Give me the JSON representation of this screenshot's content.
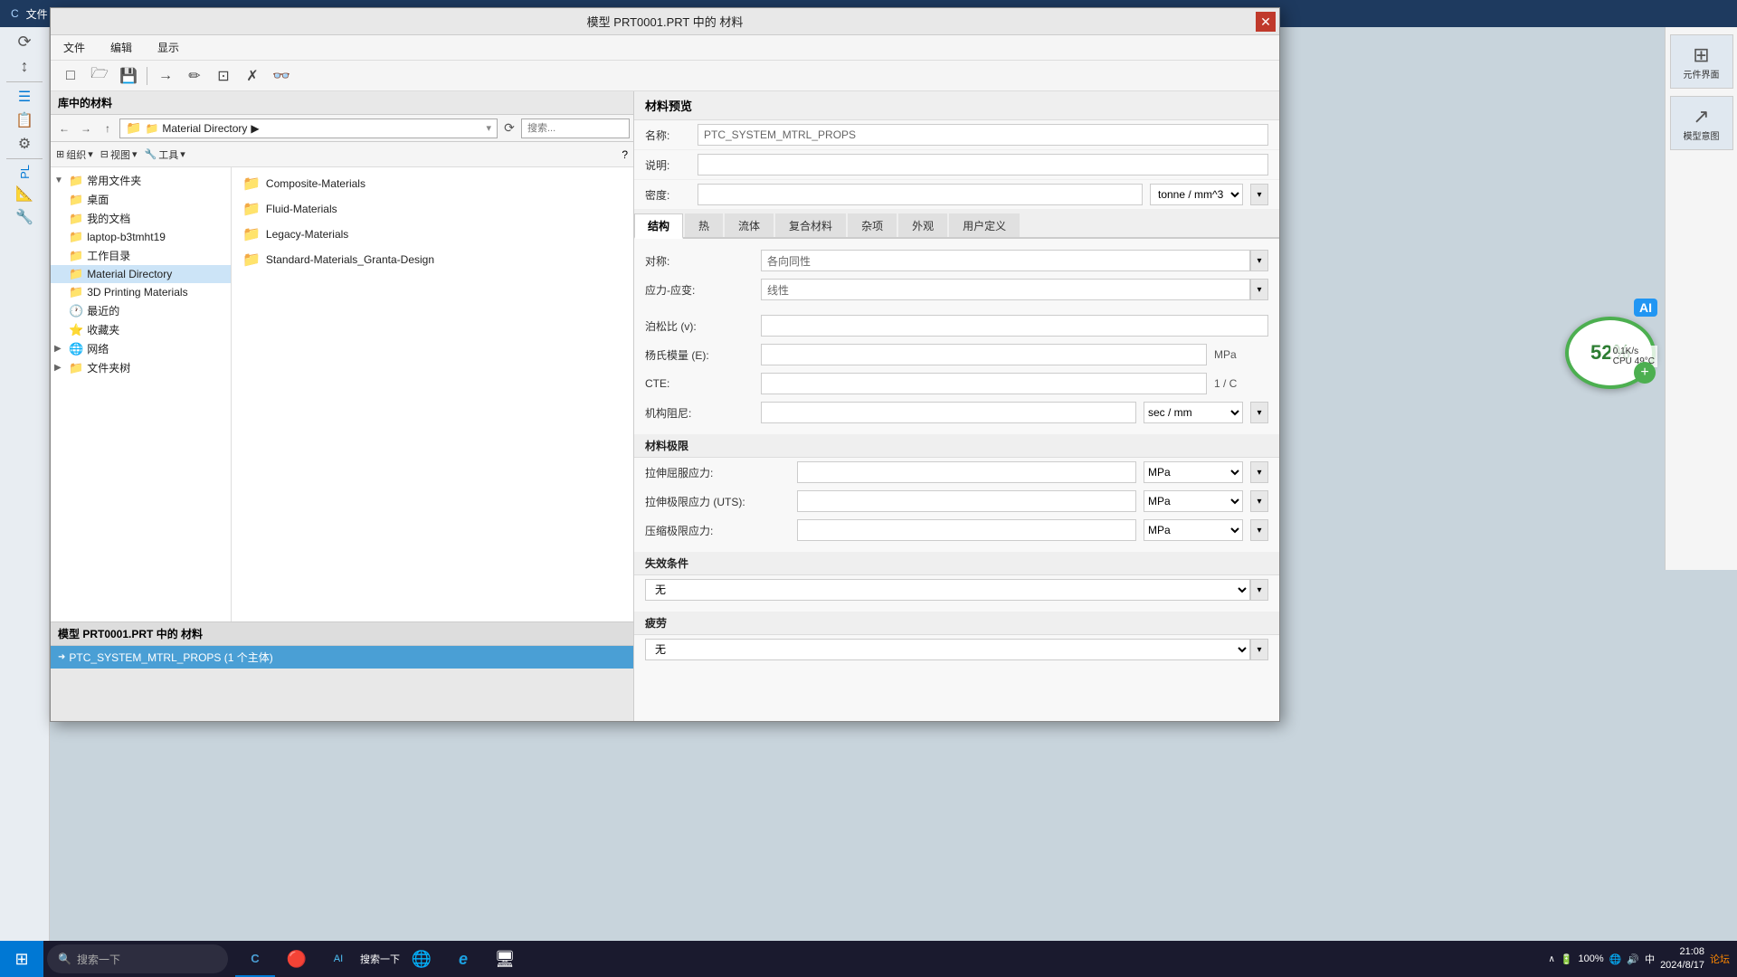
{
  "app": {
    "title": "模型 PRT0001.PRT 中的 材料",
    "bg_color": "#6a8a9e"
  },
  "dialog": {
    "title": "模型 PRT0001.PRT 中的 材料",
    "close_label": "✕"
  },
  "menubar": {
    "items": [
      "文件",
      "编辑",
      "显示"
    ]
  },
  "toolbar": {
    "buttons": [
      "□",
      "□↑",
      "💾",
      "→",
      "✏",
      "⊡",
      "✗",
      "👓"
    ]
  },
  "library_header": "库中的材料",
  "address_bar": {
    "path_label": "Material Directory",
    "path_arrow": "▶",
    "search_placeholder": "搜索..."
  },
  "file_toolbar": {
    "organize_label": "组织",
    "view_label": "视图",
    "tools_label": "工具",
    "chevron": "▾"
  },
  "tree": {
    "common_folder": {
      "label": "常用文件夹",
      "toggle": "▼",
      "items": [
        {
          "label": "桌面",
          "icon": "folder",
          "indent": 1
        },
        {
          "label": "我的文档",
          "icon": "folder",
          "indent": 1
        },
        {
          "label": "laptop-b3tmht19",
          "icon": "folder",
          "indent": 1
        },
        {
          "label": "工作目录",
          "icon": "folder",
          "indent": 1
        },
        {
          "label": "Material Directory",
          "icon": "folder_special",
          "indent": 1,
          "selected": true
        },
        {
          "label": "3D Printing Materials",
          "icon": "folder_special",
          "indent": 1
        },
        {
          "label": "最近的",
          "icon": "folder_time",
          "indent": 1
        },
        {
          "label": "收藏夹",
          "icon": "folder_star",
          "indent": 1
        }
      ]
    },
    "network": {
      "label": "网络",
      "toggle": "▶"
    },
    "file_tree": {
      "label": "文件夹树",
      "toggle": "▶"
    }
  },
  "files": [
    {
      "name": "Composite-Materials",
      "icon": "folder"
    },
    {
      "name": "Fluid-Materials",
      "icon": "folder"
    },
    {
      "name": "Legacy-Materials",
      "icon": "folder"
    },
    {
      "name": "Standard-Materials_Granta-Design",
      "icon": "folder"
    }
  ],
  "material_list": {
    "header": "模型 PRT0001.PRT 中的 材料",
    "items": [
      {
        "label": "PTC_SYSTEM_MTRL_PROPS (1 个主体)",
        "selected": true
      }
    ]
  },
  "properties": {
    "header": "材料预览",
    "name_label": "名称:",
    "name_value": "PTC_SYSTEM_MTRL_PROPS",
    "desc_label": "说明:",
    "desc_value": "",
    "density_label": "密度:",
    "density_value": "",
    "density_unit": "tonne / mm^3",
    "tabs": [
      "结构",
      "热",
      "流体",
      "复合材料",
      "杂项",
      "外观",
      "用户定义"
    ],
    "active_tab": "结构",
    "symmetry_label": "对称:",
    "symmetry_value": "各向同性",
    "stress_strain_label": "应力-应变:",
    "stress_strain_value": "线性",
    "poisson_label": "泊松比 (v):",
    "poisson_value": "",
    "youngs_label": "杨氏模量 (E):",
    "youngs_value": "",
    "youngs_unit": "MPa",
    "cte_label": "CTE:",
    "cte_value": "",
    "cte_unit": "1 / C",
    "damping_label": "机构阻尼:",
    "damping_value": "",
    "damping_unit": "sec / mm",
    "limits_header": "材料极限",
    "tensile_yield_label": "拉伸屈服应力:",
    "tensile_yield_value": "",
    "tensile_yield_unit": "MPa",
    "tensile_ult_label": "拉伸极限应力 (UTS):",
    "tensile_ult_value": "",
    "tensile_ult_unit": "MPa",
    "compress_label": "压缩极限应力:",
    "compress_value": "",
    "compress_unit": "MPa",
    "failure_header": "失效条件",
    "failure_value": "无",
    "fatigue_header": "疲劳",
    "fatigue_value": "无"
  },
  "cpu_widget": {
    "percent": "52%",
    "ai_label": "AI",
    "speed_label": "0.1K/s",
    "cpu_temp": "CPU 49°C",
    "add_icon": "+"
  },
  "right_panel": {
    "items": [
      {
        "label": "元件界面",
        "icon": "⊞"
      },
      {
        "label": "模型意图",
        "icon": "↗"
      }
    ]
  },
  "taskbar": {
    "start_icon": "⊞",
    "search_placeholder": "搜索一下",
    "apps": [
      {
        "label": "C",
        "icon": "C",
        "active": true
      },
      {
        "label": "🔴",
        "icon": "🔴"
      },
      {
        "label": "AI",
        "icon": "🤖"
      },
      {
        "label": "搜",
        "icon": "搜"
      },
      {
        "label": "🌐",
        "icon": "🌐"
      },
      {
        "label": "IE",
        "icon": "e"
      },
      {
        "label": "🖥",
        "icon": "🖥"
      }
    ],
    "tray_icons": [
      "🔋",
      "🔊",
      "🌐",
      "中"
    ],
    "time": "21:08",
    "date": "2024/8/17"
  }
}
